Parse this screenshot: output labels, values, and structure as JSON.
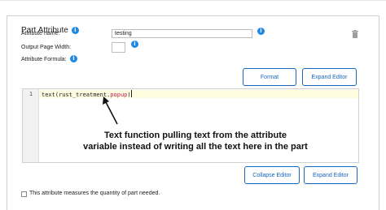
{
  "panel": {
    "legend_title": "Part Attribute",
    "legend_info_icon": "info-icon"
  },
  "fields": {
    "attribute_name_label": "Attribute name:",
    "attribute_name_value": "testing",
    "output_page_width_label": "Output Page Width:",
    "output_page_width_value": "",
    "attribute_formula_label": "Attribute Formula:"
  },
  "buttons": {
    "format": "Format",
    "expand_editor_top": "Expand Editor",
    "collapse_editor": "Collapse Editor",
    "expand_editor_bottom": "Expand Editor"
  },
  "editor": {
    "line_number": "1",
    "code_prefix": "text(rust_treatment.",
    "code_property": "popup",
    "code_suffix": ")"
  },
  "annotation": {
    "line1": "Text function pulling text from the attribute",
    "line2": "variable instead of writing all the text here in the part"
  },
  "footer": {
    "quantity_checkbox_label": "This attribute measures the quantity of part needed."
  },
  "colors": {
    "accent": "#1565c0",
    "info": "#1e88e5",
    "code_property": "#c2185b",
    "active_line": "#fffde0"
  }
}
